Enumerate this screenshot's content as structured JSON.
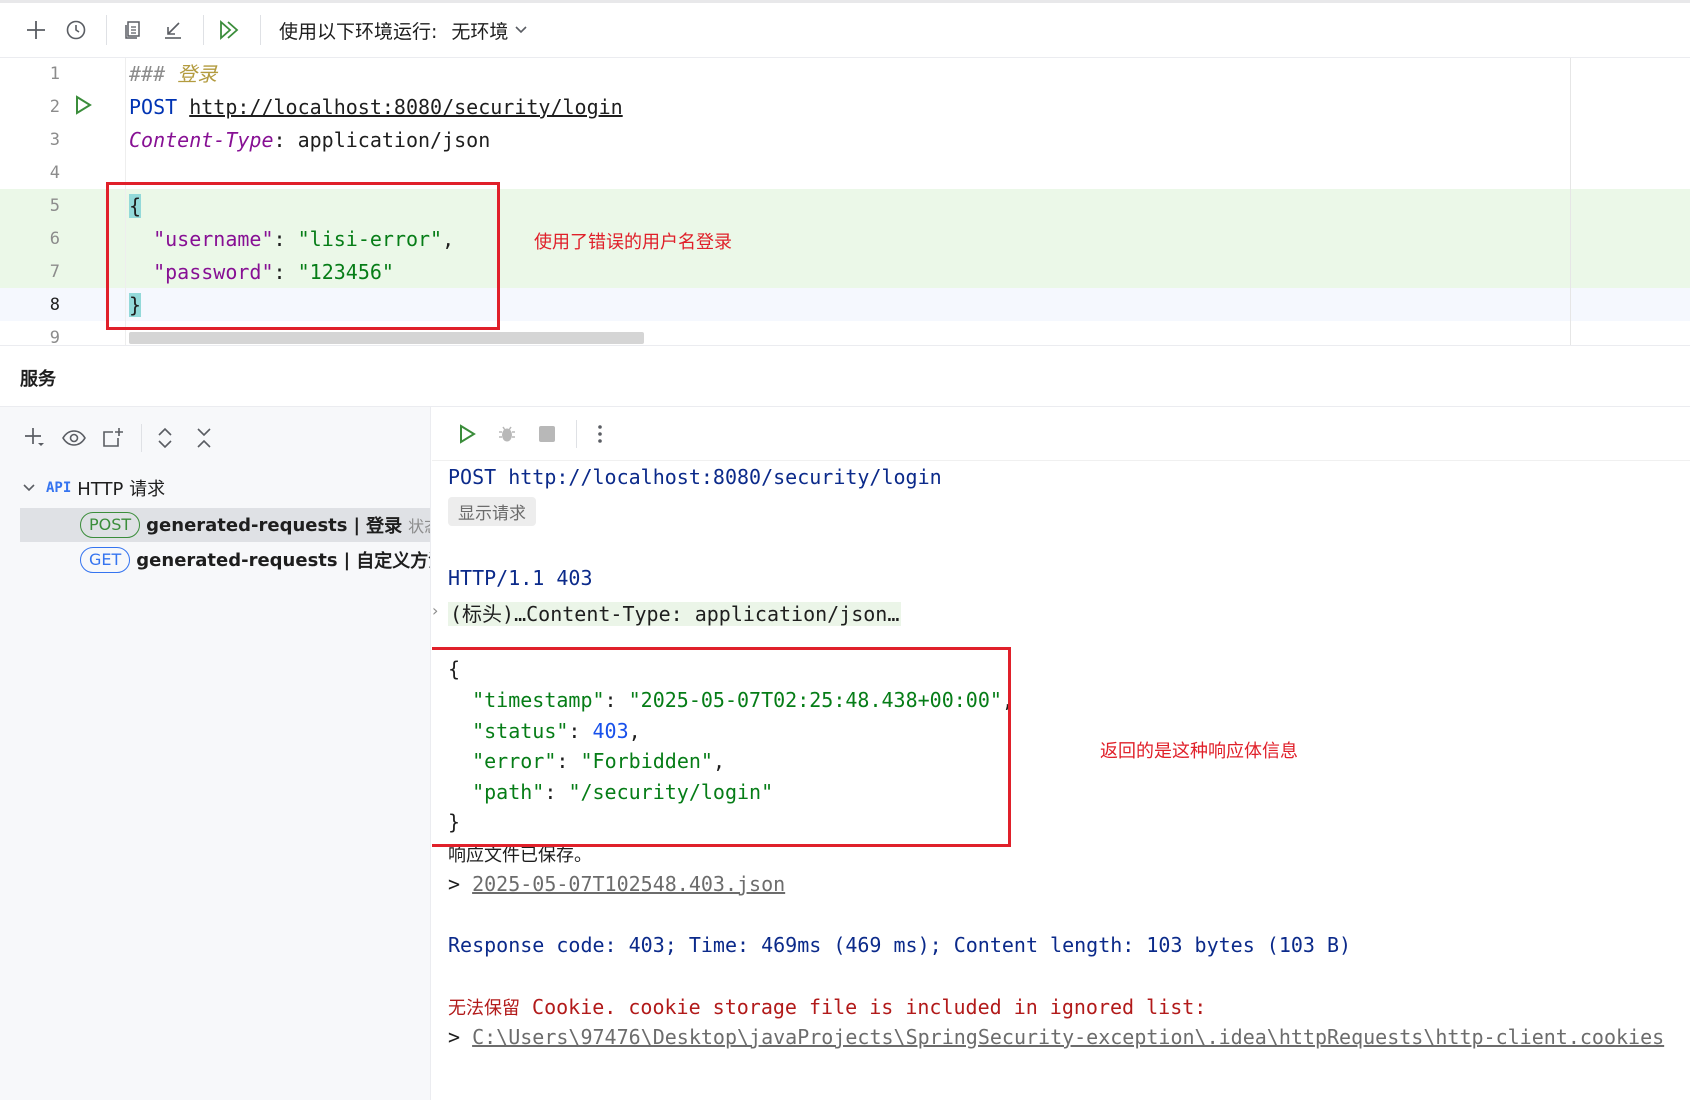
{
  "toolbar": {
    "env_label": "使用以下环境运行:",
    "env_value": "无环境"
  },
  "editor": {
    "line_numbers": [
      "1",
      "2",
      "3",
      "4",
      "5",
      "6",
      "7",
      "8",
      "9"
    ],
    "line1_hash": "###",
    "line1_title": "登录",
    "line2_method": "POST",
    "line2_url": "http://localhost:8080/security/login",
    "line3_header_name": "Content-Type",
    "line3_header_sep": ":",
    "line3_header_value": "application/json",
    "line5_open": "{",
    "line6_key": "\"username\"",
    "line6_val": "\"lisi-error\"",
    "line7_key": "\"password\"",
    "line7_val": "\"123456\"",
    "line8_close": "}",
    "annotation": "使用了错误的用户名登录"
  },
  "services": {
    "title": "服务",
    "tree_root_label": "HTTP 请求",
    "tree_root_icon": "API",
    "requests": [
      {
        "method": "POST",
        "name": "generated-requests",
        "sep": "|",
        "title": "登录",
        "state": "状态"
      },
      {
        "method": "GET",
        "name": "generated-requests",
        "sep": "|",
        "title": "自定义方法",
        "state": ""
      }
    ]
  },
  "response": {
    "request_line": "POST http://localhost:8080/security/login",
    "show_request": "显示请求",
    "status_line": "HTTP/1.1 403",
    "headers_summary": "(标头)…Content-Type: application/json…",
    "body_open": "{",
    "body_close": "}",
    "ts_key": "\"timestamp\"",
    "ts_val": "\"2025-05-07T02:25:48.438+00:00\"",
    "status_key": "\"status\"",
    "status_val": "403",
    "error_key": "\"error\"",
    "error_val": "\"Forbidden\"",
    "path_key": "\"path\"",
    "path_val": "\"/security/login\"",
    "saved_text": "响应文件已保存。",
    "saved_prefix": ">",
    "saved_file": "2025-05-07T102548.403.json",
    "summary": "Response code: 403; Time: 469ms (469 ms); Content length: 103 bytes (103 B)",
    "cookie_cn": "无法保留",
    "cookie_text": "Cookie. cookie storage file is included in ignored list:",
    "cookie_prefix": ">",
    "cookie_path": "C:\\Users\\97476\\Desktop\\javaProjects\\SpringSecurity-exception\\.idea\\httpRequests\\http-client.cookies",
    "annotation": "返回的是这种响应体信息"
  },
  "colors": {
    "annotation_red": "#e0202a",
    "run_green": "#3b8d3b",
    "keyword_blue": "#0033b3",
    "string_green": "#067d17",
    "key_purple": "#871094"
  }
}
